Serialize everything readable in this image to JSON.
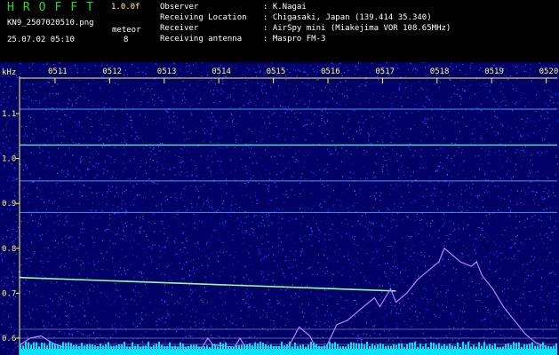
{
  "header": {
    "app_title": "HROFFT",
    "version": "1.0.0f",
    "file_name": "KN9_2507020510.png",
    "mode": "meteor",
    "timestamp": "25.07.02 05:10",
    "count": "8",
    "fields": [
      {
        "key": "Observer",
        "value": ": K.Nagai"
      },
      {
        "key": "Receiving Location",
        "value": ": Chigasaki, Japan (139.414 35.340)"
      },
      {
        "key": "Receiver",
        "value": ": AirSpy mini (Miakejima VOR 108.65MHz)"
      },
      {
        "key": "Receiving antenna",
        "value": ": Maspro FM-3"
      }
    ]
  },
  "chart_data": {
    "type": "heatmap",
    "ylabel": "kHz",
    "x_ticks": [
      "0511",
      "0512",
      "0513",
      "0514",
      "0515",
      "0516",
      "0517",
      "0518",
      "0519",
      "0520"
    ],
    "y_ticks": [
      "1.1",
      "1.0",
      "0.9",
      "0.8",
      "0.7",
      "0.6"
    ],
    "ylim": [
      0.58,
      1.19
    ],
    "xlim": [
      0,
      10
    ],
    "colors": {
      "background": "#000066",
      "axis": "#ffff66",
      "trace": "#c080ff",
      "noise_floor": "#00e5ff"
    },
    "horizontal_lines_khz": [
      1.11,
      1.03,
      0.95,
      0.88
    ],
    "meteor_trail": {
      "start": [
        0.0,
        0.735
      ],
      "end": [
        7.0,
        0.705
      ]
    },
    "signal_trace": [
      [
        0.0,
        0.585
      ],
      [
        0.2,
        0.6
      ],
      [
        0.4,
        0.605
      ],
      [
        0.6,
        0.59
      ],
      [
        0.8,
        0.58
      ],
      [
        3.4,
        0.58
      ],
      [
        3.5,
        0.6
      ],
      [
        3.6,
        0.585
      ],
      [
        4.0,
        0.58
      ],
      [
        4.1,
        0.6
      ],
      [
        4.2,
        0.58
      ],
      [
        5.0,
        0.58
      ],
      [
        5.2,
        0.625
      ],
      [
        5.4,
        0.605
      ],
      [
        5.5,
        0.58
      ],
      [
        5.7,
        0.58
      ],
      [
        5.9,
        0.63
      ],
      [
        6.1,
        0.64
      ],
      [
        6.3,
        0.66
      ],
      [
        6.5,
        0.68
      ],
      [
        6.6,
        0.69
      ],
      [
        6.7,
        0.67
      ],
      [
        6.8,
        0.69
      ],
      [
        6.9,
        0.71
      ],
      [
        7.0,
        0.68
      ],
      [
        7.2,
        0.7
      ],
      [
        7.4,
        0.73
      ],
      [
        7.6,
        0.75
      ],
      [
        7.8,
        0.77
      ],
      [
        7.9,
        0.8
      ],
      [
        8.0,
        0.79
      ],
      [
        8.2,
        0.77
      ],
      [
        8.4,
        0.76
      ],
      [
        8.5,
        0.77
      ],
      [
        8.6,
        0.74
      ],
      [
        8.8,
        0.71
      ],
      [
        9.0,
        0.67
      ],
      [
        9.2,
        0.64
      ],
      [
        9.4,
        0.61
      ],
      [
        9.6,
        0.59
      ],
      [
        9.8,
        0.58
      ]
    ]
  }
}
